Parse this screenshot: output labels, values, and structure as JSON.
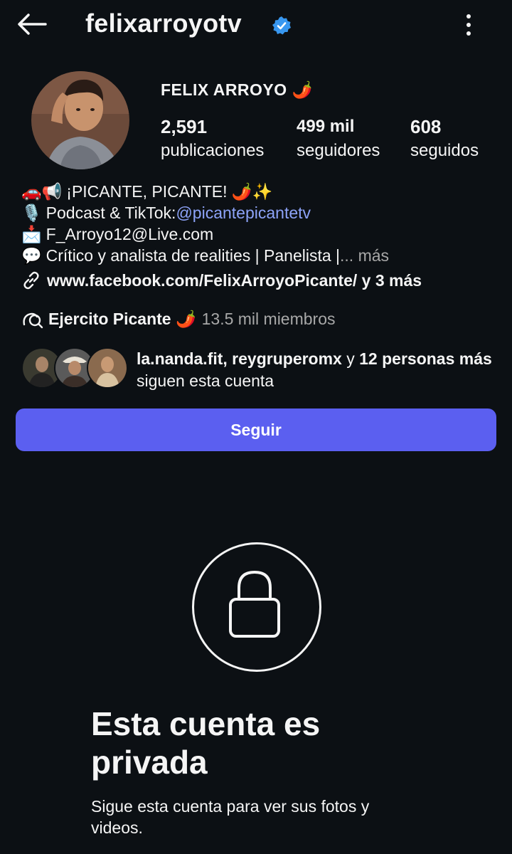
{
  "header": {
    "username": "felixarroyotv",
    "back_icon": "arrow-left-icon",
    "verified_icon": "verified-badge-icon",
    "menu_icon": "more-vertical-icon"
  },
  "profile": {
    "display_name": "FELIX ARROYO 🌶️",
    "stats": [
      {
        "value": "2,591",
        "label": "publicaciones"
      },
      {
        "value": "499 mil",
        "label": "seguidores"
      },
      {
        "value": "608",
        "label": "seguidos"
      }
    ]
  },
  "bio": {
    "line1_emoji": "🚗📢",
    "line1_text": "¡PICANTE, PICANTE! 🌶️✨",
    "line2_emoji": "🎙️",
    "line2_text": "Podcast & TikTok: ",
    "line2_mention": "@picantepicantetv",
    "line3_emoji": "📩",
    "line3_text": "F_Arroyo12@Live.com",
    "line4_emoji": "💬",
    "line4_text": "Crítico y analista de realities | Panelista | ",
    "line4_more": "... más",
    "link_text": "www.facebook.com/FelixArroyoPicante/ y 3 más"
  },
  "channel": {
    "name": "Ejercito Picante 🌶️",
    "members": "13.5 mil miembros"
  },
  "followed_by": {
    "names": "la.nanda.fit, reygruperomx",
    "connector": " y ",
    "others": "12 personas más",
    "suffix": " siguen esta cuenta"
  },
  "actions": {
    "follow_label": "Seguir"
  },
  "private": {
    "title": "Esta cuenta es privada",
    "subtitle": "Sigue esta cuenta para ver sus fotos y videos."
  },
  "colors": {
    "background": "#0c1014",
    "accent": "#5b5ff0",
    "mention": "#8da3f8",
    "verified": "#3897f0"
  }
}
